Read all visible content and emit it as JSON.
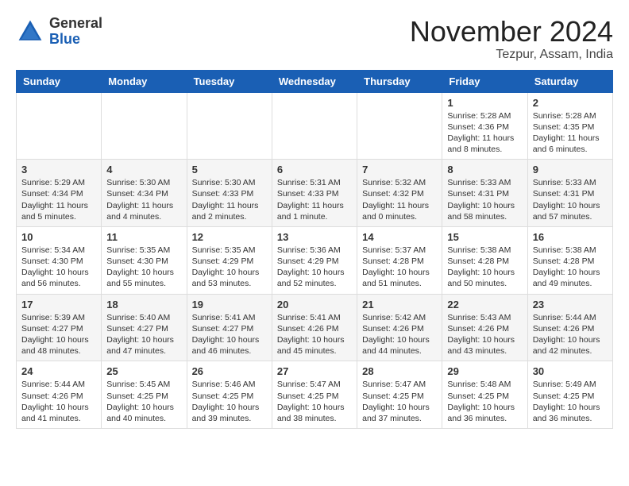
{
  "header": {
    "logo_general": "General",
    "logo_blue": "Blue",
    "month_title": "November 2024",
    "location": "Tezpur, Assam, India"
  },
  "weekdays": [
    "Sunday",
    "Monday",
    "Tuesday",
    "Wednesday",
    "Thursday",
    "Friday",
    "Saturday"
  ],
  "weeks": [
    [
      {
        "day": "",
        "info": ""
      },
      {
        "day": "",
        "info": ""
      },
      {
        "day": "",
        "info": ""
      },
      {
        "day": "",
        "info": ""
      },
      {
        "day": "",
        "info": ""
      },
      {
        "day": "1",
        "info": "Sunrise: 5:28 AM\nSunset: 4:36 PM\nDaylight: 11 hours and 8 minutes."
      },
      {
        "day": "2",
        "info": "Sunrise: 5:28 AM\nSunset: 4:35 PM\nDaylight: 11 hours and 6 minutes."
      }
    ],
    [
      {
        "day": "3",
        "info": "Sunrise: 5:29 AM\nSunset: 4:34 PM\nDaylight: 11 hours and 5 minutes."
      },
      {
        "day": "4",
        "info": "Sunrise: 5:30 AM\nSunset: 4:34 PM\nDaylight: 11 hours and 4 minutes."
      },
      {
        "day": "5",
        "info": "Sunrise: 5:30 AM\nSunset: 4:33 PM\nDaylight: 11 hours and 2 minutes."
      },
      {
        "day": "6",
        "info": "Sunrise: 5:31 AM\nSunset: 4:33 PM\nDaylight: 11 hours and 1 minute."
      },
      {
        "day": "7",
        "info": "Sunrise: 5:32 AM\nSunset: 4:32 PM\nDaylight: 11 hours and 0 minutes."
      },
      {
        "day": "8",
        "info": "Sunrise: 5:33 AM\nSunset: 4:31 PM\nDaylight: 10 hours and 58 minutes."
      },
      {
        "day": "9",
        "info": "Sunrise: 5:33 AM\nSunset: 4:31 PM\nDaylight: 10 hours and 57 minutes."
      }
    ],
    [
      {
        "day": "10",
        "info": "Sunrise: 5:34 AM\nSunset: 4:30 PM\nDaylight: 10 hours and 56 minutes."
      },
      {
        "day": "11",
        "info": "Sunrise: 5:35 AM\nSunset: 4:30 PM\nDaylight: 10 hours and 55 minutes."
      },
      {
        "day": "12",
        "info": "Sunrise: 5:35 AM\nSunset: 4:29 PM\nDaylight: 10 hours and 53 minutes."
      },
      {
        "day": "13",
        "info": "Sunrise: 5:36 AM\nSunset: 4:29 PM\nDaylight: 10 hours and 52 minutes."
      },
      {
        "day": "14",
        "info": "Sunrise: 5:37 AM\nSunset: 4:28 PM\nDaylight: 10 hours and 51 minutes."
      },
      {
        "day": "15",
        "info": "Sunrise: 5:38 AM\nSunset: 4:28 PM\nDaylight: 10 hours and 50 minutes."
      },
      {
        "day": "16",
        "info": "Sunrise: 5:38 AM\nSunset: 4:28 PM\nDaylight: 10 hours and 49 minutes."
      }
    ],
    [
      {
        "day": "17",
        "info": "Sunrise: 5:39 AM\nSunset: 4:27 PM\nDaylight: 10 hours and 48 minutes."
      },
      {
        "day": "18",
        "info": "Sunrise: 5:40 AM\nSunset: 4:27 PM\nDaylight: 10 hours and 47 minutes."
      },
      {
        "day": "19",
        "info": "Sunrise: 5:41 AM\nSunset: 4:27 PM\nDaylight: 10 hours and 46 minutes."
      },
      {
        "day": "20",
        "info": "Sunrise: 5:41 AM\nSunset: 4:26 PM\nDaylight: 10 hours and 45 minutes."
      },
      {
        "day": "21",
        "info": "Sunrise: 5:42 AM\nSunset: 4:26 PM\nDaylight: 10 hours and 44 minutes."
      },
      {
        "day": "22",
        "info": "Sunrise: 5:43 AM\nSunset: 4:26 PM\nDaylight: 10 hours and 43 minutes."
      },
      {
        "day": "23",
        "info": "Sunrise: 5:44 AM\nSunset: 4:26 PM\nDaylight: 10 hours and 42 minutes."
      }
    ],
    [
      {
        "day": "24",
        "info": "Sunrise: 5:44 AM\nSunset: 4:26 PM\nDaylight: 10 hours and 41 minutes."
      },
      {
        "day": "25",
        "info": "Sunrise: 5:45 AM\nSunset: 4:25 PM\nDaylight: 10 hours and 40 minutes."
      },
      {
        "day": "26",
        "info": "Sunrise: 5:46 AM\nSunset: 4:25 PM\nDaylight: 10 hours and 39 minutes."
      },
      {
        "day": "27",
        "info": "Sunrise: 5:47 AM\nSunset: 4:25 PM\nDaylight: 10 hours and 38 minutes."
      },
      {
        "day": "28",
        "info": "Sunrise: 5:47 AM\nSunset: 4:25 PM\nDaylight: 10 hours and 37 minutes."
      },
      {
        "day": "29",
        "info": "Sunrise: 5:48 AM\nSunset: 4:25 PM\nDaylight: 10 hours and 36 minutes."
      },
      {
        "day": "30",
        "info": "Sunrise: 5:49 AM\nSunset: 4:25 PM\nDaylight: 10 hours and 36 minutes."
      }
    ]
  ]
}
